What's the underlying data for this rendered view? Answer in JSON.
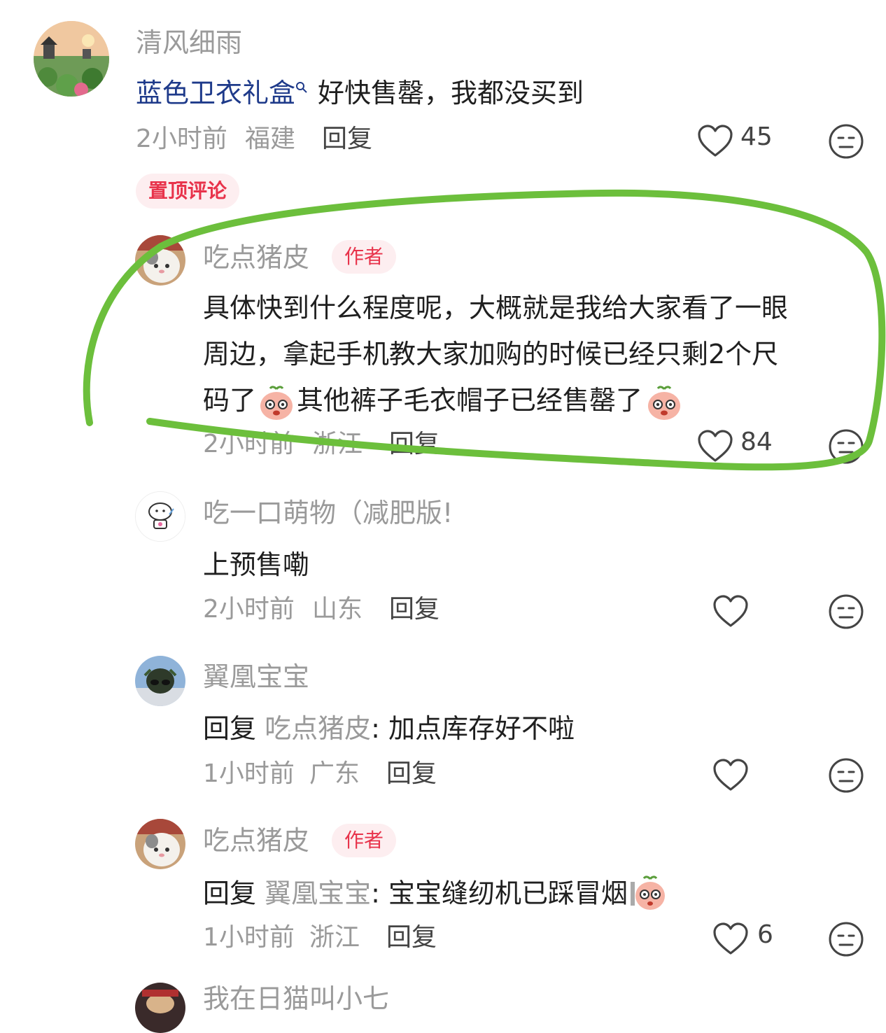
{
  "colors": {
    "username_gray": "#9a9a9a",
    "text": "#1f1f1f",
    "link_blue": "#1e3a8a",
    "badge_red": "#e8334b",
    "badge_bg": "#fdeef0",
    "highlight_green": "#6cbf3c"
  },
  "comments": [
    {
      "username": "清风细雨",
      "link_text": "蓝色卫衣礼盒",
      "text": "好快售罄，我都没买到",
      "time": "2小时前",
      "location": "福建",
      "reply_label": "回复",
      "likes": "45",
      "pinned_label": "置顶评论"
    },
    {
      "username": "吃点猪皮",
      "badge": "作者",
      "lines": [
        "具体快到什么程度呢，大概就是我给大家看了一眼",
        "周边，拿起手机教大家加购的时候已经只剩2个尺",
        "码了",
        "其他裤子毛衣帽子已经售罄了"
      ],
      "time": "2小时前",
      "location": "浙江",
      "reply_label": "回复",
      "likes": "84"
    },
    {
      "username": "吃一口萌物（减肥版!",
      "text": "上预售嘞",
      "time": "2小时前",
      "location": "山东",
      "reply_label": "回复"
    },
    {
      "username": "翼凰宝宝",
      "reply_prefix": "回复",
      "reply_to": "吃点猪皮",
      "text": ": 加点库存好不啦",
      "time": "1小时前",
      "location": "广东",
      "reply_label": "回复"
    },
    {
      "username": "吃点猪皮",
      "badge": "作者",
      "reply_prefix": "回复",
      "reply_to": "翼凰宝宝",
      "text": ": 宝宝缝纫机已踩冒烟",
      "time": "1小时前",
      "location": "浙江",
      "reply_label": "回复",
      "likes": "6"
    },
    {
      "username": "我在日猫叫小七"
    }
  ],
  "icons": {
    "like": "heart-outline-icon",
    "dislike": "neutral-face-icon",
    "search_hint": "search-small-icon",
    "emoji": "pig-face-emoji-icon"
  }
}
